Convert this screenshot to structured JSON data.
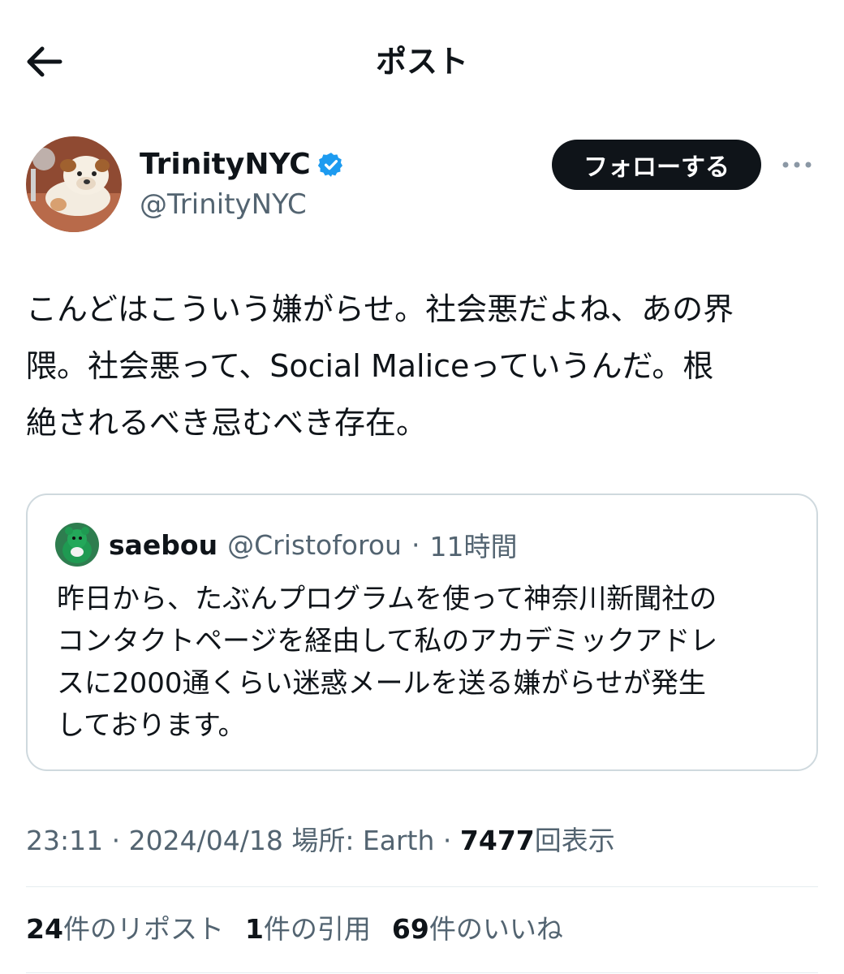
{
  "header": {
    "title": "ポスト"
  },
  "author": {
    "display_name": "TrinityNYC",
    "handle": "@TrinityNYC",
    "verified_color": "#1d9bf0",
    "follow_label": "フォローする"
  },
  "tweet": {
    "text": "こんどはこういう嫌がらせ。社会悪だよね、あの界\n隈。社会悪って、Social Maliceっていうんだ。根\n絶されるべき忌むべき存在。"
  },
  "quote": {
    "name": "saebou",
    "handle": "@Cristoforou",
    "separator": "·",
    "time": "11時間",
    "text": "昨日から、たぶんプログラムを使って神奈川新聞社の\nコンタクトページを経由して私のアカデミックアドレ\nスに2000通くらい迷惑メールを送る嫌がらせが発生\nしております。"
  },
  "meta": {
    "time": "23:11",
    "dot1": "·",
    "date": "2024/04/18",
    "location": "場所: Earth",
    "dot2": "·",
    "views": "7477",
    "views_label": "回表示"
  },
  "stats": {
    "reposts": "24",
    "reposts_label": "件のリポスト",
    "quotes": "1",
    "quotes_label": "件の引用",
    "likes": "69",
    "likes_label": "件のいいね"
  },
  "icons": {
    "back": "arrow-left-icon",
    "verified": "verified-badge-icon",
    "more": "more-horizontal-icon"
  }
}
